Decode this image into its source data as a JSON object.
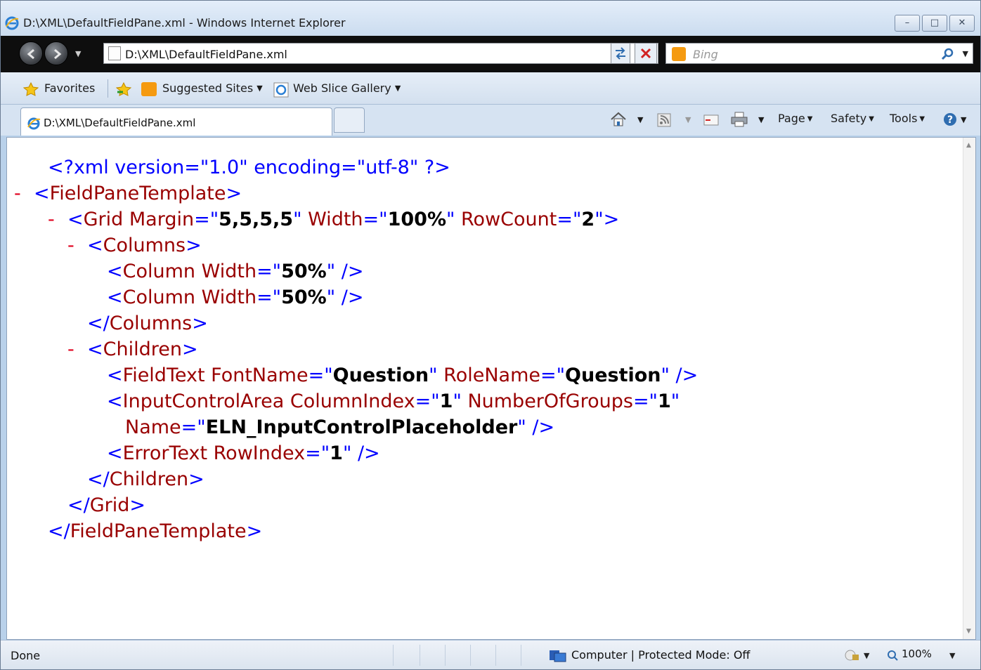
{
  "window": {
    "title": "D:\\XML\\DefaultFieldPane.xml - Windows Internet Explorer",
    "buttons": {
      "minimize": "–",
      "restore": "□",
      "close": "✕"
    }
  },
  "address_bar": {
    "url": "D:\\XML\\DefaultFieldPane.xml",
    "search_placeholder": "Bing"
  },
  "favorites_bar": {
    "favorites_label": "Favorites",
    "suggested_sites": "Suggested Sites",
    "web_slice_gallery": "Web Slice Gallery"
  },
  "tabs": [
    {
      "label": "D:\\XML\\DefaultFieldPane.xml",
      "active": true
    }
  ],
  "command_bar": {
    "page": "Page",
    "safety": "Safety",
    "tools": "Tools"
  },
  "xml_lines": [
    {
      "marker": "",
      "parts": [
        {
          "c": "b",
          "t": "<?xml version=\"1.0\" encoding=\"utf-8\" ?>"
        }
      ]
    },
    {
      "marker": "-",
      "parts": [
        {
          "c": "b",
          "t": "<"
        },
        {
          "c": "t",
          "t": "FieldPaneTemplate"
        },
        {
          "c": "b",
          "t": ">"
        }
      ]
    },
    {
      "marker": "-",
      "parts": [
        {
          "c": "b",
          "t": "<"
        },
        {
          "c": "t",
          "t": "Grid"
        },
        {
          "c": "a",
          "t": " Margin"
        },
        {
          "c": "b",
          "t": "=\""
        },
        {
          "c": "v",
          "t": "5,5,5,5"
        },
        {
          "c": "b",
          "t": "\""
        },
        {
          "c": "a",
          "t": " Width"
        },
        {
          "c": "b",
          "t": "=\""
        },
        {
          "c": "v",
          "t": "100%"
        },
        {
          "c": "b",
          "t": "\""
        },
        {
          "c": "a",
          "t": " RowCount"
        },
        {
          "c": "b",
          "t": "=\""
        },
        {
          "c": "v",
          "t": "2"
        },
        {
          "c": "b",
          "t": "\">"
        }
      ]
    },
    {
      "marker": "-",
      "parts": [
        {
          "c": "b",
          "t": "<"
        },
        {
          "c": "t",
          "t": "Columns"
        },
        {
          "c": "b",
          "t": ">"
        }
      ]
    },
    {
      "marker": "",
      "parts": [
        {
          "c": "b",
          "t": "<"
        },
        {
          "c": "t",
          "t": "Column"
        },
        {
          "c": "a",
          "t": " Width"
        },
        {
          "c": "b",
          "t": "=\""
        },
        {
          "c": "v",
          "t": "50%"
        },
        {
          "c": "b",
          "t": "\" />"
        }
      ]
    },
    {
      "marker": "",
      "parts": [
        {
          "c": "b",
          "t": "<"
        },
        {
          "c": "t",
          "t": "Column"
        },
        {
          "c": "a",
          "t": " Width"
        },
        {
          "c": "b",
          "t": "=\""
        },
        {
          "c": "v",
          "t": "50%"
        },
        {
          "c": "b",
          "t": "\" />"
        }
      ]
    },
    {
      "marker": "",
      "parts": [
        {
          "c": "b",
          "t": "</"
        },
        {
          "c": "t",
          "t": "Columns"
        },
        {
          "c": "b",
          "t": ">"
        }
      ]
    },
    {
      "marker": "-",
      "parts": [
        {
          "c": "b",
          "t": "<"
        },
        {
          "c": "t",
          "t": "Children"
        },
        {
          "c": "b",
          "t": ">"
        }
      ]
    },
    {
      "marker": "",
      "parts": [
        {
          "c": "b",
          "t": "<"
        },
        {
          "c": "t",
          "t": "FieldText"
        },
        {
          "c": "a",
          "t": " FontName"
        },
        {
          "c": "b",
          "t": "=\""
        },
        {
          "c": "v",
          "t": "Question"
        },
        {
          "c": "b",
          "t": "\""
        },
        {
          "c": "a",
          "t": " RoleName"
        },
        {
          "c": "b",
          "t": "=\""
        },
        {
          "c": "v",
          "t": "Question"
        },
        {
          "c": "b",
          "t": "\" />"
        }
      ]
    },
    {
      "marker": "",
      "parts": [
        {
          "c": "b",
          "t": "<"
        },
        {
          "c": "t",
          "t": "InputControlArea"
        },
        {
          "c": "a",
          "t": " ColumnIndex"
        },
        {
          "c": "b",
          "t": "=\""
        },
        {
          "c": "v",
          "t": "1"
        },
        {
          "c": "b",
          "t": "\""
        },
        {
          "c": "a",
          "t": " NumberOfGroups"
        },
        {
          "c": "b",
          "t": "=\""
        },
        {
          "c": "v",
          "t": "1"
        },
        {
          "c": "b",
          "t": "\""
        }
      ]
    },
    {
      "marker": "",
      "parts": [
        {
          "c": "a",
          "t": "Name"
        },
        {
          "c": "b",
          "t": "=\""
        },
        {
          "c": "v",
          "t": "ELN_InputControlPlaceholder"
        },
        {
          "c": "b",
          "t": "\" />"
        }
      ]
    },
    {
      "marker": "",
      "parts": [
        {
          "c": "b",
          "t": "<"
        },
        {
          "c": "t",
          "t": "ErrorText"
        },
        {
          "c": "a",
          "t": " RowIndex"
        },
        {
          "c": "b",
          "t": "=\""
        },
        {
          "c": "v",
          "t": "1"
        },
        {
          "c": "b",
          "t": "\" />"
        }
      ]
    },
    {
      "marker": "",
      "parts": [
        {
          "c": "b",
          "t": "</"
        },
        {
          "c": "t",
          "t": "Children"
        },
        {
          "c": "b",
          "t": ">"
        }
      ]
    },
    {
      "marker": "",
      "parts": [
        {
          "c": "b",
          "t": "</"
        },
        {
          "c": "t",
          "t": "Grid"
        },
        {
          "c": "b",
          "t": ">"
        }
      ]
    },
    {
      "marker": "",
      "parts": [
        {
          "c": "b",
          "t": "</"
        },
        {
          "c": "t",
          "t": "FieldPaneTemplate"
        },
        {
          "c": "b",
          "t": ">"
        }
      ]
    }
  ],
  "status_bar": {
    "status": "Done",
    "zone": "Computer | Protected Mode: Off",
    "zoom": "100%"
  },
  "colors": {
    "markup_blue": "#0000ff",
    "tag_red": "#990000",
    "collapse_marker": "#e0001d",
    "address_bar_bg": "#0e0e0e"
  }
}
